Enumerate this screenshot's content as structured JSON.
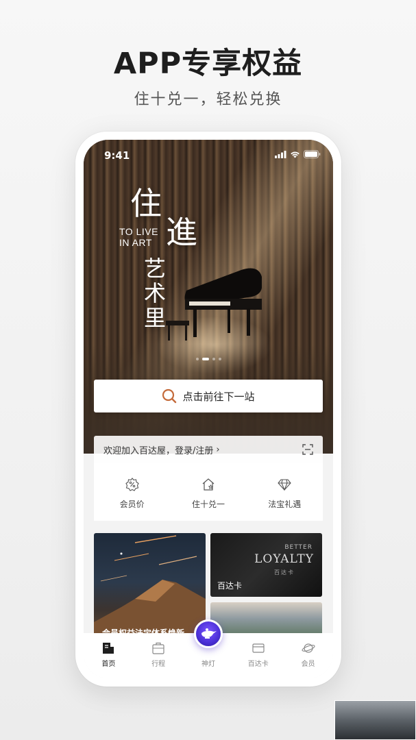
{
  "promo": {
    "headline": "APP专享权益",
    "subline": "住十兑一，轻松兑换"
  },
  "status_bar": {
    "time": "9:41",
    "icons": [
      "signal-icon",
      "wifi-icon",
      "battery-icon"
    ]
  },
  "hero": {
    "title_line1_char1": "住",
    "title_line1_char2": "進",
    "title_line2_char1": "艺",
    "title_line2_char2": "术",
    "title_line2_char3": "里",
    "english_line1": "TO LIVE",
    "english_line2": "IN ART",
    "carousel_total": 4,
    "carousel_active": 2
  },
  "search": {
    "label": "点击前往下一站",
    "icon": "search-icon"
  },
  "welcome": {
    "text": "欢迎加入百达屋，登录/注册",
    "chevron": "›",
    "scan_icon": "scan-icon"
  },
  "quick_actions": [
    {
      "label": "会员价",
      "icon": "discount-icon"
    },
    {
      "label": "住十兑一",
      "icon": "house-star-icon"
    },
    {
      "label": "法宝礼遇",
      "icon": "diamond-icon"
    }
  ],
  "cards": {
    "left_caption": "会员权益法宝体系焕新",
    "loyalty_top": "BETTER",
    "loyalty_main": "LOYALTY",
    "loyalty_sub": "百达卡",
    "loyalty_caption": "百达卡"
  },
  "tabbar": [
    {
      "label": "首页",
      "icon": "home-icon",
      "active": true
    },
    {
      "label": "行程",
      "icon": "luggage-icon",
      "active": false
    },
    {
      "label": "神灯",
      "icon": "magic-lamp-icon",
      "active": false
    },
    {
      "label": "百达卡",
      "icon": "card-icon",
      "active": false
    },
    {
      "label": "会员",
      "icon": "planet-icon",
      "active": false
    }
  ],
  "colors": {
    "accent": "#c46a3a",
    "lamp": "#5a3be0",
    "text_dark": "#1e1e1e"
  }
}
